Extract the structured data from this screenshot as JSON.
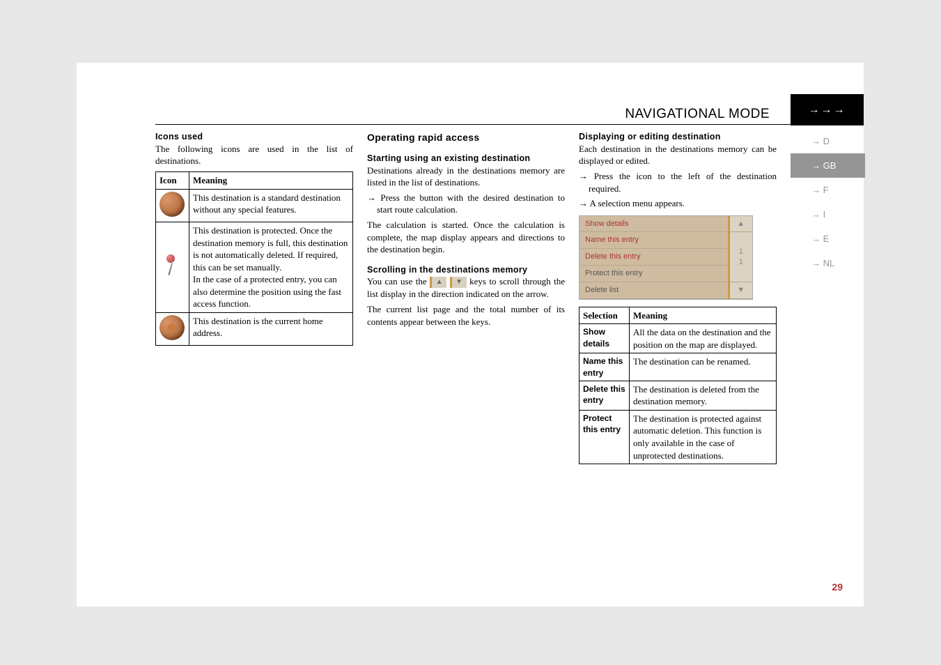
{
  "header": {
    "section_title": "NAVIGATIONAL MODE",
    "arrows": "→→→"
  },
  "sidebar": {
    "items": [
      {
        "label": "→ D",
        "active": false
      },
      {
        "label": "→ GB",
        "active": true
      },
      {
        "label": "→ F",
        "active": false
      },
      {
        "label": "→ I",
        "active": false
      },
      {
        "label": "→ E",
        "active": false
      },
      {
        "label": "→ NL",
        "active": false
      }
    ]
  },
  "col1": {
    "heading": "Icons used",
    "intro": "The following icons are used in the list of destinations.",
    "table": {
      "head_icon": "Icon",
      "head_meaning": "Meaning",
      "rows": [
        {
          "icon": "globe",
          "text": "This destination is a standard destination without any special features."
        },
        {
          "icon": "pin",
          "text": "This destination is protected. Once the destination memory is full, this destination is not automatically deleted. If required, this can be set manually.\nIn the case of a protected entry, you can also determine the position using the fast access function."
        },
        {
          "icon": "home",
          "text": "This destination is the current home address."
        }
      ]
    }
  },
  "col2": {
    "heading": "Operating rapid access",
    "sub1": "Starting using an existing destination",
    "p1": "Destinations already in the destinations memory are listed in the list of destinations.",
    "step1": "Press the button with the desired destination to start route calculation.",
    "p2": "The calculation is started. Once the calculation is complete, the map display appears and directions to the destination begin.",
    "sub2": "Scrolling in the destinations memory",
    "p3a": "You can use the",
    "p3b": "keys to scroll through the list display in the direction indicated on the arrow.",
    "p4": "The current list page and the total number of its contents appear between the keys."
  },
  "col3": {
    "heading": "Displaying or editing destination",
    "p1": "Each destination in the destinations memory can be displayed or edited.",
    "step1": "Press the icon to the left of the destination required.",
    "step2": "A selection menu appears.",
    "menu": {
      "items": [
        "Show details",
        "Name this entry",
        "Delete this entry",
        "Protect this entry",
        "Delete list"
      ],
      "page_indicator": "1\n1",
      "up": "▲",
      "down": "▼"
    },
    "table": {
      "head_sel": "Selection",
      "head_meaning": "Meaning",
      "rows": [
        {
          "sel": "Show details",
          "text": "All the data on the destination and the position on the map are displayed."
        },
        {
          "sel": "Name this entry",
          "text": "The destination can be renamed."
        },
        {
          "sel": "Delete this entry",
          "text": "The destination is deleted from the destination memory."
        },
        {
          "sel": "Protect this entry",
          "text": "The destination is protected against automatic deletion. This function is only available in the case of unprotected destinations."
        }
      ]
    }
  },
  "page_number": "29"
}
